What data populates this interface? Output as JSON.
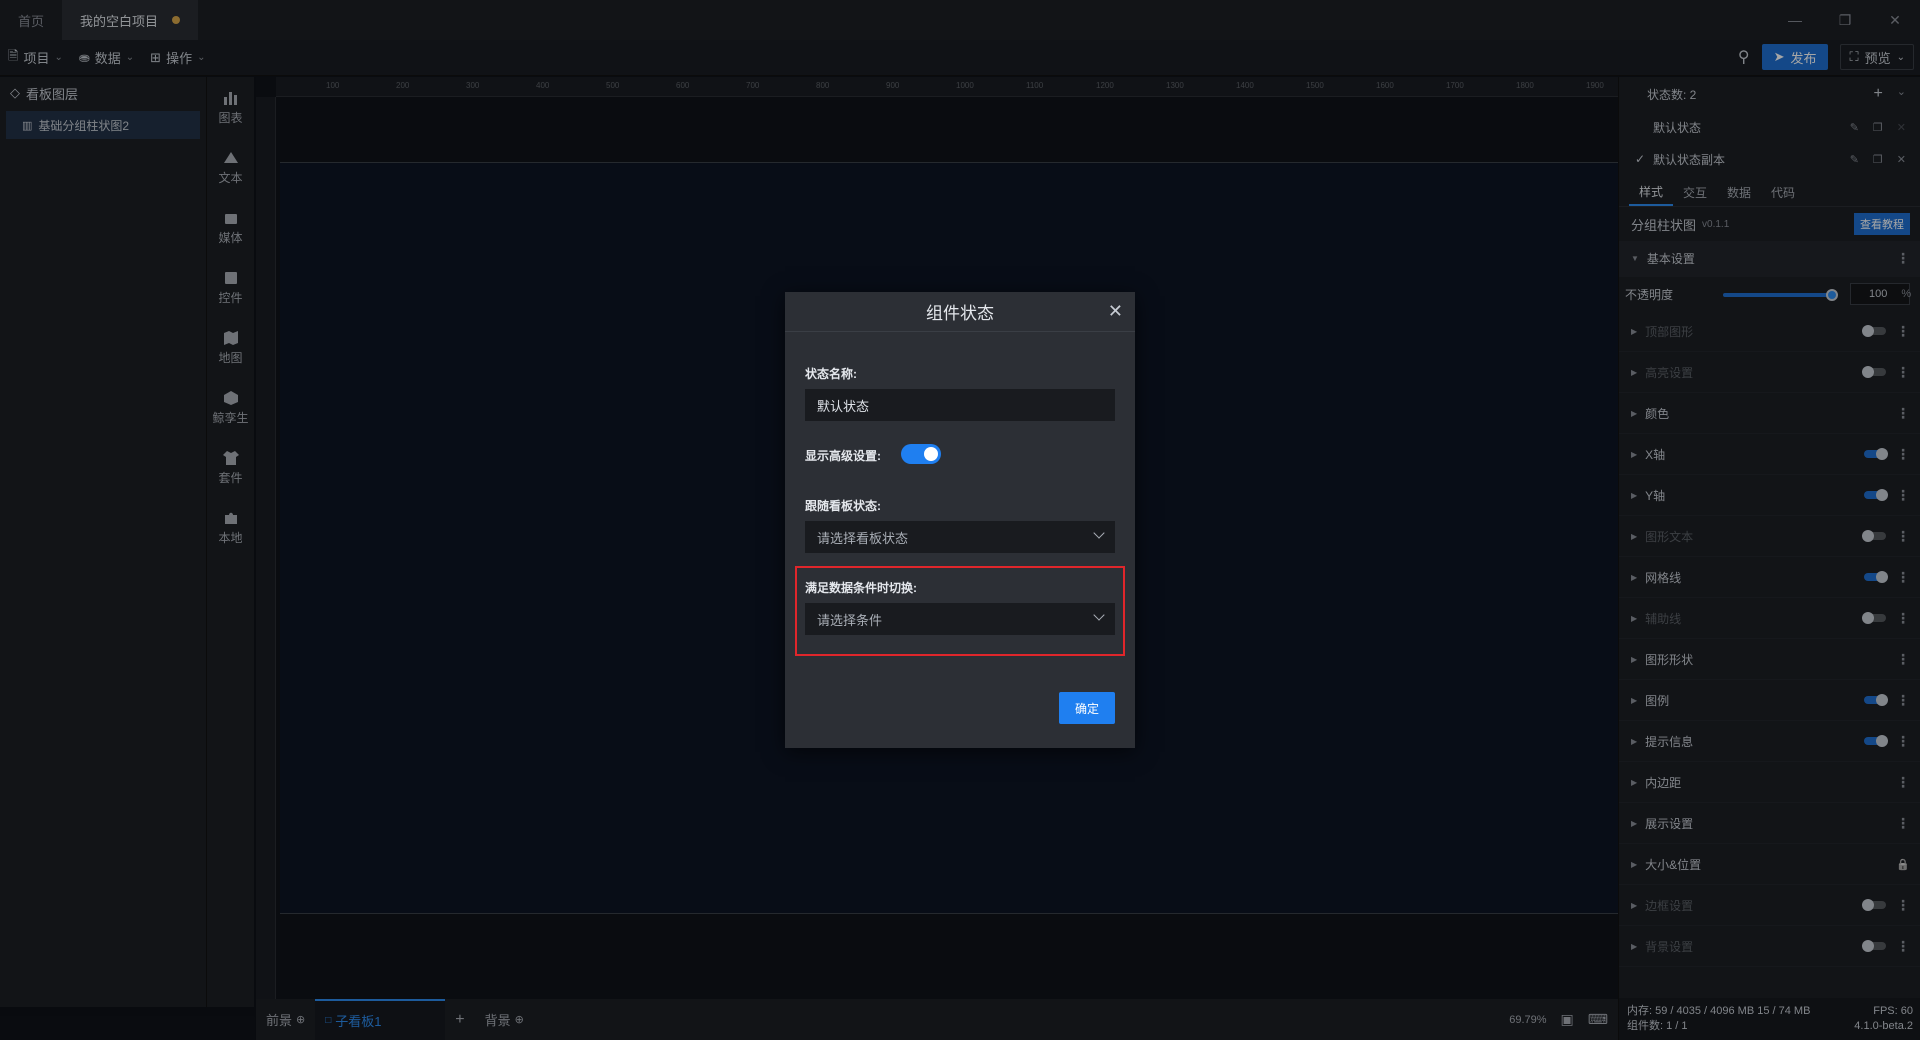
{
  "tabs": [
    {
      "label": "首页"
    },
    {
      "label": "我的空白项目"
    }
  ],
  "toolbar": {
    "project": "项目",
    "data": "数据",
    "operate": "操作",
    "publish": "发布",
    "preview": "预览"
  },
  "left_panel": {
    "title": "看板图层",
    "layer": "基础分组柱状图2"
  },
  "icon_bar": [
    {
      "label": "图表",
      "icon": "bar-chart-icon"
    },
    {
      "label": "文本",
      "icon": "text-icon"
    },
    {
      "label": "媒体",
      "icon": "media-icon"
    },
    {
      "label": "控件",
      "icon": "control-icon"
    },
    {
      "label": "地图",
      "icon": "map-icon"
    },
    {
      "label": "鲸孪生",
      "icon": "cube-icon"
    },
    {
      "label": "套件",
      "icon": "shirt-icon"
    },
    {
      "label": "本地",
      "icon": "puzzle-icon"
    }
  ],
  "ruler_ticks": [
    "100",
    "200",
    "300",
    "400",
    "500",
    "600",
    "700",
    "800",
    "900",
    "1000",
    "1100",
    "1200",
    "1300",
    "1400",
    "1500",
    "1600",
    "1700",
    "1800",
    "1900"
  ],
  "bottom": {
    "foreground": "前景",
    "sub_board": "子看板1",
    "background": "背景",
    "zoom": "69.79%"
  },
  "right_panel": {
    "state_count": "状态数: 2",
    "states": [
      "默认状态",
      "默认状态副本"
    ],
    "tabs": [
      "样式",
      "交互",
      "数据",
      "代码"
    ],
    "component_name": "分组柱状图",
    "version": "v0.1.1",
    "tutorial": "查看教程",
    "basic_settings": "基本设置",
    "opacity_label": "不透明度",
    "opacity_value": "100",
    "opacity_unit": "%",
    "opacity_level": 100,
    "sections": [
      {
        "label": "顶部图形",
        "dim": true,
        "toggle": "off"
      },
      {
        "label": "高亮设置",
        "dim": true,
        "toggle": "off"
      },
      {
        "label": "颜色",
        "dim": false,
        "toggle": "none"
      },
      {
        "label": "X轴",
        "dim": false,
        "toggle": "on"
      },
      {
        "label": "Y轴",
        "dim": false,
        "toggle": "on"
      },
      {
        "label": "图形文本",
        "dim": true,
        "toggle": "off"
      },
      {
        "label": "网格线",
        "dim": false,
        "toggle": "on"
      },
      {
        "label": "辅助线",
        "dim": true,
        "toggle": "off"
      },
      {
        "label": "图形形状",
        "dim": false,
        "toggle": "none"
      },
      {
        "label": "图例",
        "dim": false,
        "toggle": "on"
      },
      {
        "label": "提示信息",
        "dim": false,
        "toggle": "on"
      },
      {
        "label": "内边距",
        "dim": false,
        "toggle": "none"
      },
      {
        "label": "展示设置",
        "dim": false,
        "toggle": "none"
      },
      {
        "label": "大小&位置",
        "dim": false,
        "toggle": "lock"
      },
      {
        "label": "边框设置",
        "dim": true,
        "toggle": "off"
      },
      {
        "label": "背景设置",
        "dim": true,
        "toggle": "off"
      }
    ],
    "status_mem": "内存: 59 / 4035 / 4096 MB 15 / 74 MB",
    "status_fps": "FPS: 60",
    "status_components": "组件数: 1 / 1",
    "status_version": "4.1.0-beta.2"
  },
  "modal": {
    "title": "组件状态",
    "name_label": "状态名称:",
    "name_value": "默认状态",
    "advanced_label": "显示高级设置:",
    "advanced_on": true,
    "follow_label": "跟随看板状态:",
    "follow_placeholder": "请选择看板状态",
    "condition_label": "满足数据条件时切换:",
    "condition_placeholder": "请选择条件",
    "confirm": "确定"
  }
}
